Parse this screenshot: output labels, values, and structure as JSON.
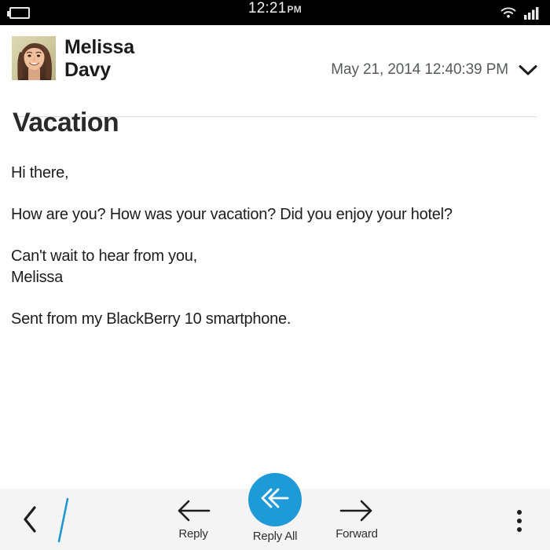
{
  "status_bar": {
    "battery_icon": "battery-icon",
    "time": "12:21",
    "meridiem": "PM",
    "wifi_icon": "wifi-icon",
    "signal_icon": "signal-bars-icon",
    "background_color": "#000000",
    "text_color": "#f2f2f2"
  },
  "message": {
    "avatar_icon": "contact-avatar-photo",
    "sender_name": "Melissa\nDavy",
    "sender_first_name": "Melissa",
    "sender_last_name": "Davy",
    "date": "May 21, 2014 12:40:39 PM",
    "expand_icon": "chevron-down-icon",
    "subject": "Vacation",
    "body_paragraphs": [
      "Hi there,",
      "How are you? How was your vacation? Did you enjoy your hotel?",
      "Can't wait to hear from you,\nMelissa",
      "Sent from my BlackBerry 10 smartphone."
    ]
  },
  "action_bar": {
    "background_color": "#f4f4f4",
    "back_icon": "chevron-left-icon",
    "divider_icon": "diagonal-slash-divider",
    "divider_color": "#1e9ad6",
    "accent_color": "#1e9ad6",
    "actions": [
      {
        "label": "Reply",
        "icon": "arrow-left-icon"
      },
      {
        "label": "Reply All",
        "icon": "double-chevron-left-icon"
      },
      {
        "label": "Forward",
        "icon": "arrow-right-icon"
      }
    ],
    "overflow_icon": "overflow-menu-icon"
  }
}
